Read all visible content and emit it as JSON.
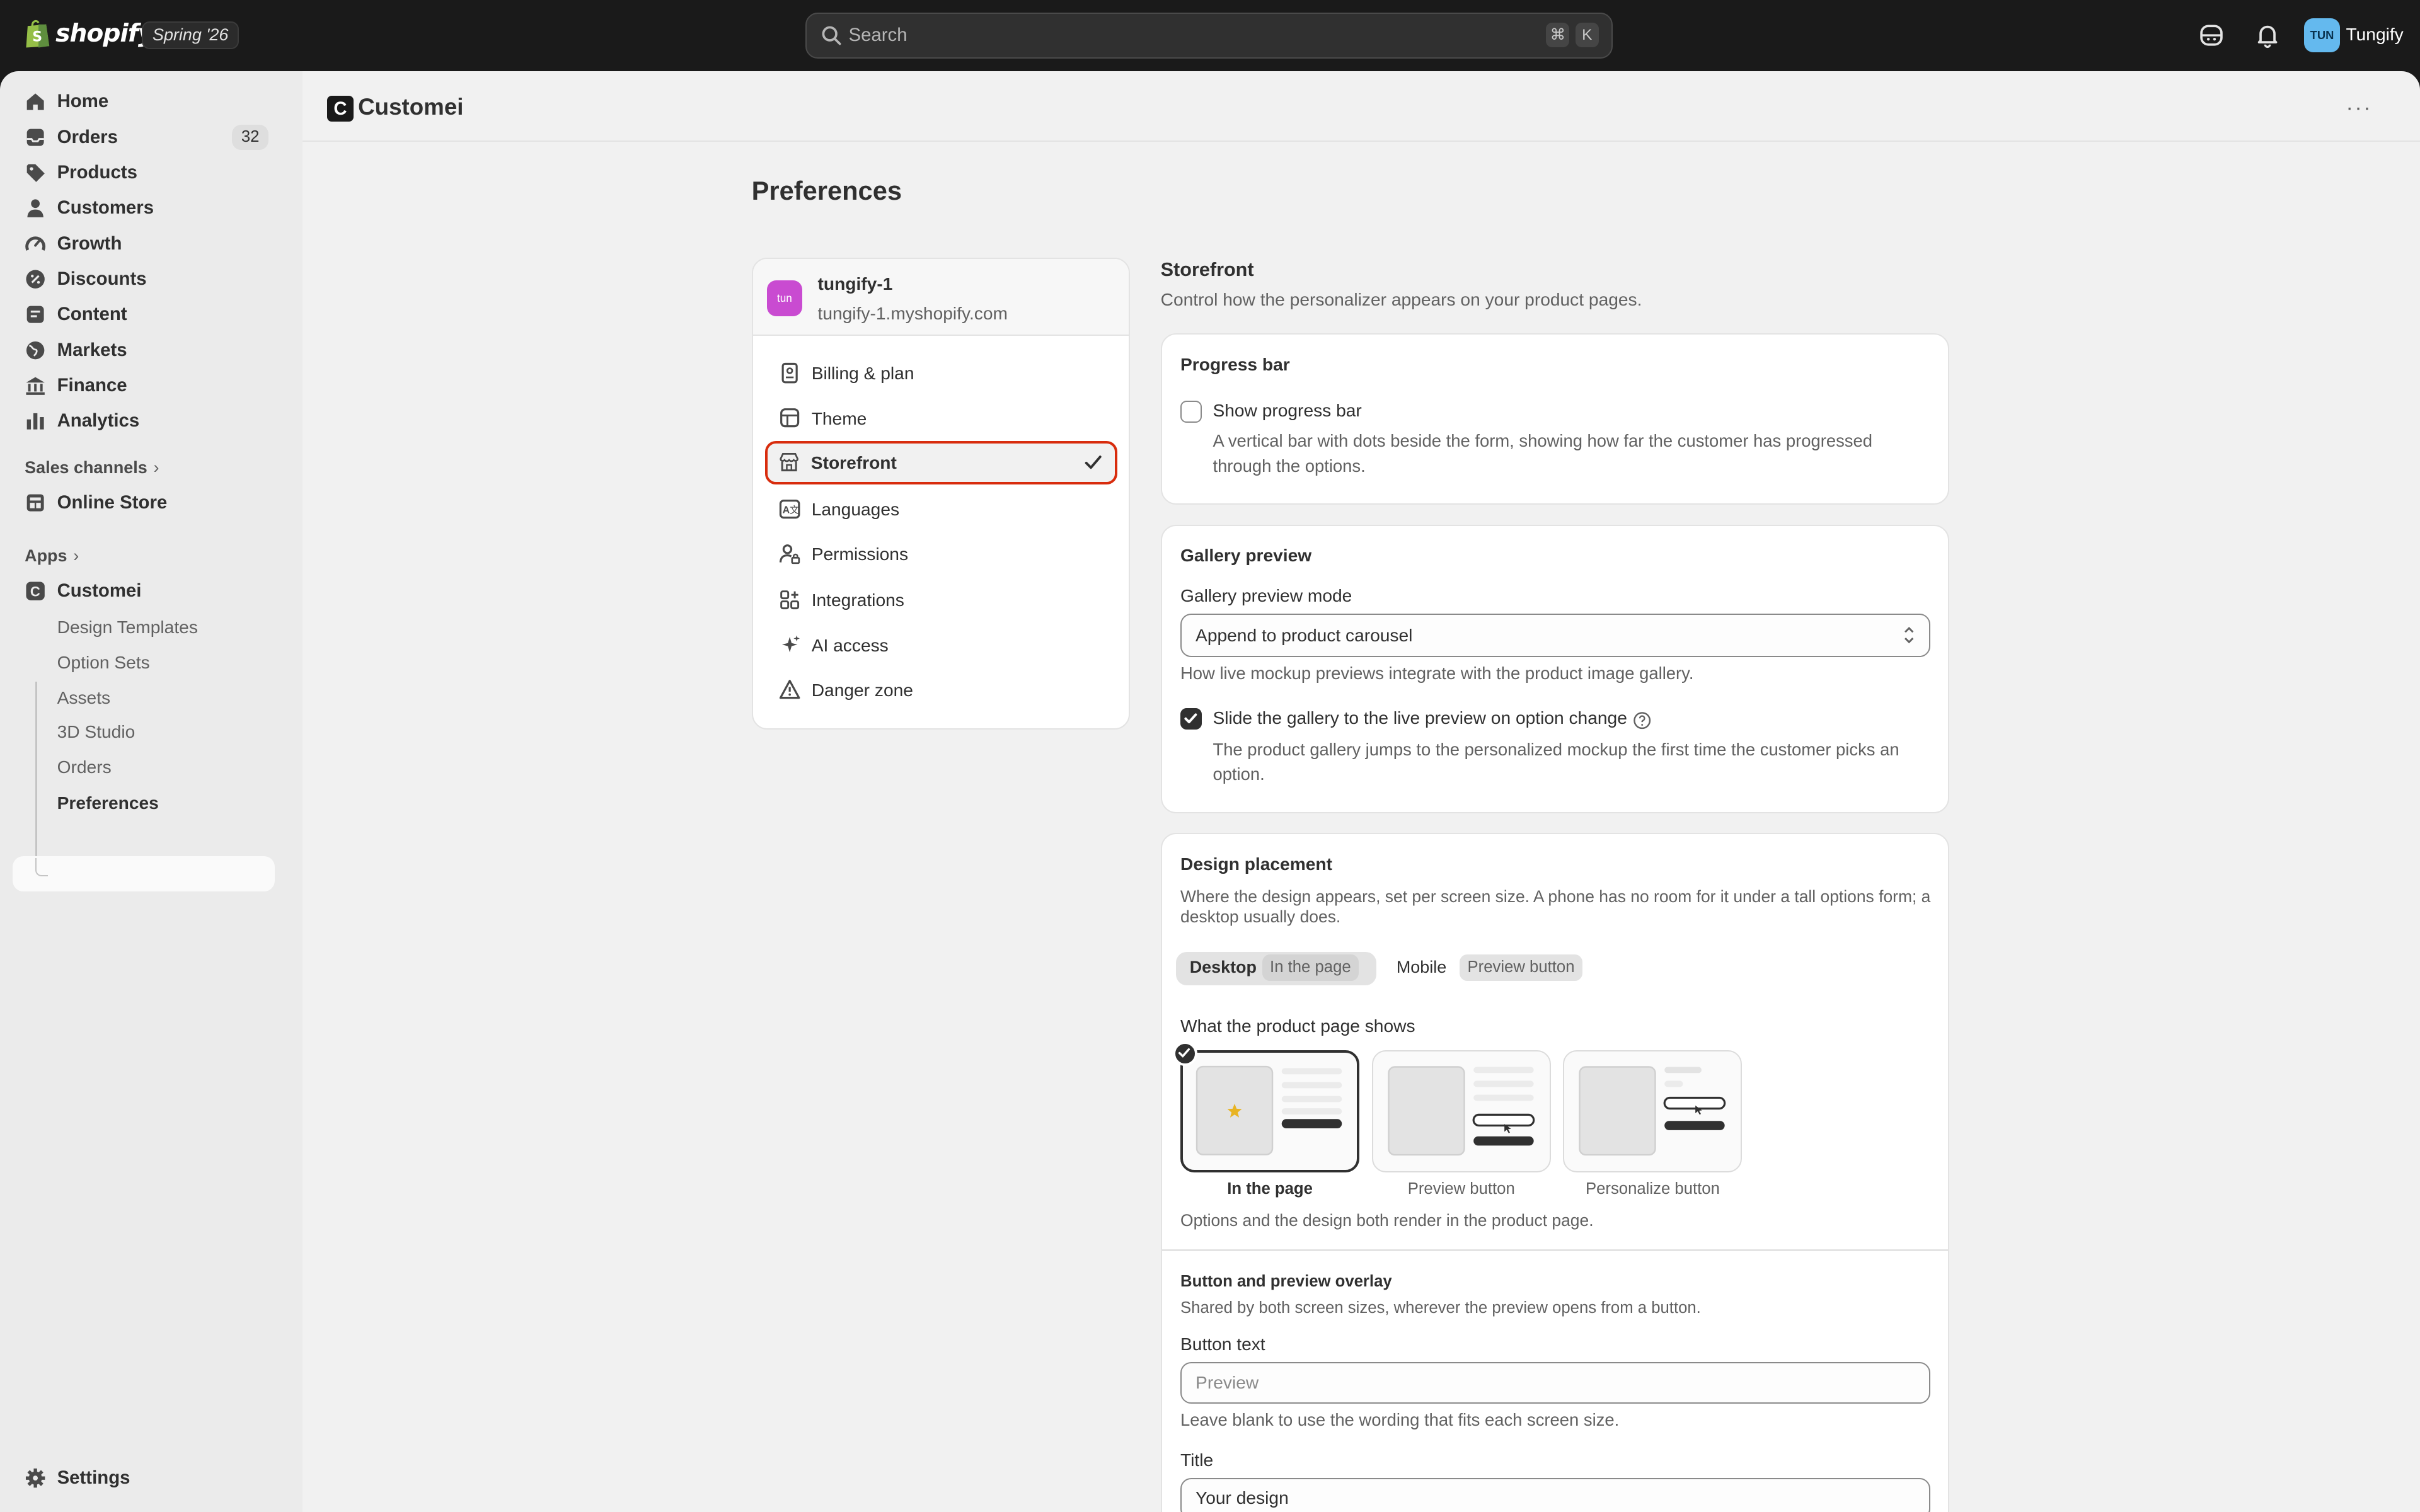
{
  "topbar": {
    "brand": "shopify",
    "edition": "Spring '26",
    "search_placeholder": "Search",
    "shortcut_mod": "⌘",
    "shortcut_key": "K",
    "avatar_initials": "TUN",
    "store_name": "Tungify"
  },
  "sidebar": {
    "items": [
      {
        "label": "Home",
        "icon": "home-icon"
      },
      {
        "label": "Orders",
        "icon": "inbox-icon",
        "badge": "32"
      },
      {
        "label": "Products",
        "icon": "tag-icon"
      },
      {
        "label": "Customers",
        "icon": "person-icon"
      },
      {
        "label": "Growth",
        "icon": "gauge-icon"
      },
      {
        "label": "Discounts",
        "icon": "discount-icon"
      },
      {
        "label": "Content",
        "icon": "content-icon"
      },
      {
        "label": "Markets",
        "icon": "globe-icon"
      },
      {
        "label": "Finance",
        "icon": "bank-icon"
      },
      {
        "label": "Analytics",
        "icon": "bar-chart-icon"
      }
    ],
    "sales_channels_label": "Sales channels",
    "online_store": "Online Store",
    "apps_label": "Apps",
    "app_name": "Customei",
    "app_subitems": [
      "Design Templates",
      "Option Sets",
      "Assets",
      "3D Studio",
      "Orders",
      "Preferences"
    ],
    "settings": "Settings"
  },
  "app_header": {
    "logo_letter": "C",
    "title": "Customei",
    "more": "···"
  },
  "page": {
    "title": "Preferences",
    "store": {
      "avatar": "tun",
      "name": "tungify-1",
      "domain": "tungify-1.myshopify.com"
    },
    "menu": [
      {
        "label": "Billing & plan",
        "icon": "receipt-icon"
      },
      {
        "label": "Theme",
        "icon": "theme-icon"
      },
      {
        "label": "Storefront",
        "icon": "storefront-icon",
        "active": true
      },
      {
        "label": "Languages",
        "icon": "languages-icon"
      },
      {
        "label": "Permissions",
        "icon": "permissions-icon"
      },
      {
        "label": "Integrations",
        "icon": "integrations-icon"
      },
      {
        "label": "AI access",
        "icon": "sparkle-icon"
      },
      {
        "label": "Danger zone",
        "icon": "warning-icon"
      }
    ]
  },
  "storefront": {
    "title": "Storefront",
    "description": "Control how the personalizer appears on your product pages.",
    "progress_bar": {
      "title": "Progress bar",
      "checkbox_label": "Show progress bar",
      "checked": false,
      "help": "A vertical bar with dots beside the form, showing how far the customer has progressed through the options."
    },
    "gallery_preview": {
      "title": "Gallery preview",
      "mode_label": "Gallery preview mode",
      "mode_value": "Append to product carousel",
      "mode_hint": "How live mockup previews integrate with the product image gallery.",
      "slide_label": "Slide the gallery to the live preview on option change",
      "slide_checked": true,
      "slide_help": "The product gallery jumps to the personalized mockup the first time the customer picks an option."
    },
    "design_placement": {
      "title": "Design placement",
      "description": "Where the design appears, set per screen size. A phone has no room for it under a tall options form; a desktop usually does.",
      "tabs": [
        {
          "label": "Desktop",
          "tag": "In the page",
          "active": true
        },
        {
          "label": "Mobile",
          "tag": "Preview button",
          "active": false
        }
      ],
      "shows_label": "What the product page shows",
      "options": [
        {
          "label": "In the page",
          "selected": true
        },
        {
          "label": "Preview button",
          "selected": false
        },
        {
          "label": "Personalize button",
          "selected": false
        }
      ],
      "options_hint": "Options and the design both render in the product page.",
      "overlay_title": "Button and preview overlay",
      "overlay_desc": "Shared by both screen sizes, wherever the preview opens from a button.",
      "button_text_label": "Button text",
      "button_text_placeholder": "Preview",
      "button_text_hint": "Leave blank to use the wording that fits each screen size.",
      "title_label": "Title",
      "title_value": "Your design"
    }
  },
  "colors": {
    "topbar": "#1a1a1a",
    "sidebar": "#ebebeb",
    "main": "#f1f1f1",
    "active_outline": "#d82c0d",
    "store_avatar": "#c94bd1",
    "user_avatar": "#64b9ee",
    "star": "#e8b423"
  }
}
